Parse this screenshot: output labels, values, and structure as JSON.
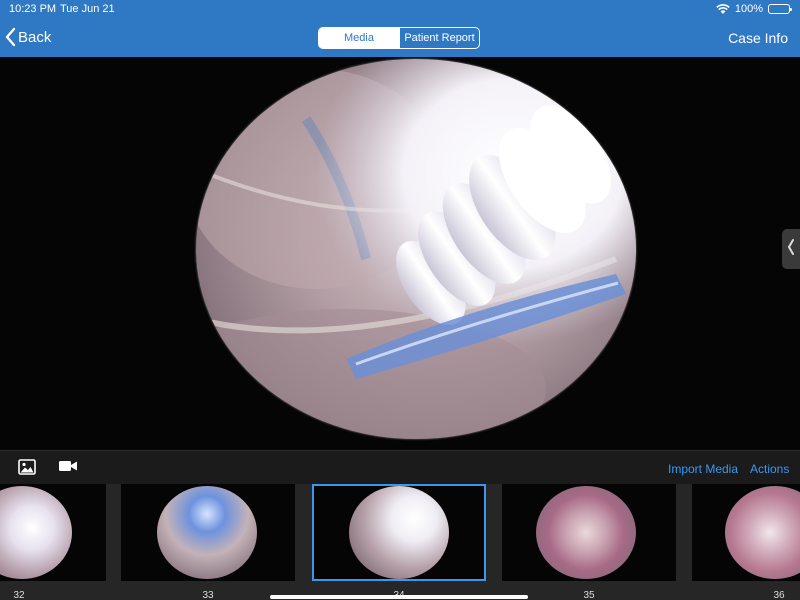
{
  "status_bar": {
    "time": "10:23 PM",
    "date": "Tue Jun 21",
    "battery": "100%",
    "battery_level": 1.0,
    "wifi_icon": "wifi-icon",
    "battery_icon": "battery-icon"
  },
  "nav": {
    "back_label": "Back",
    "tabs": [
      {
        "label": "Media",
        "active": true
      },
      {
        "label": "Patient Report",
        "active": false
      }
    ],
    "case_info_label": "Case Info"
  },
  "toolbar": {
    "photo_icon": "photo-icon",
    "video_icon": "video-camera-icon",
    "import_label": "Import Media",
    "actions_label": "Actions"
  },
  "thumbnails": [
    {
      "label": "32",
      "selected": false
    },
    {
      "label": "33",
      "selected": false
    },
    {
      "label": "34",
      "selected": true
    },
    {
      "label": "35",
      "selected": false
    },
    {
      "label": "36",
      "selected": false
    }
  ],
  "colors": {
    "header": "#2f78c4",
    "accent": "#3b96f0",
    "background": "#000000",
    "toolbar": "#1b1b1b"
  }
}
